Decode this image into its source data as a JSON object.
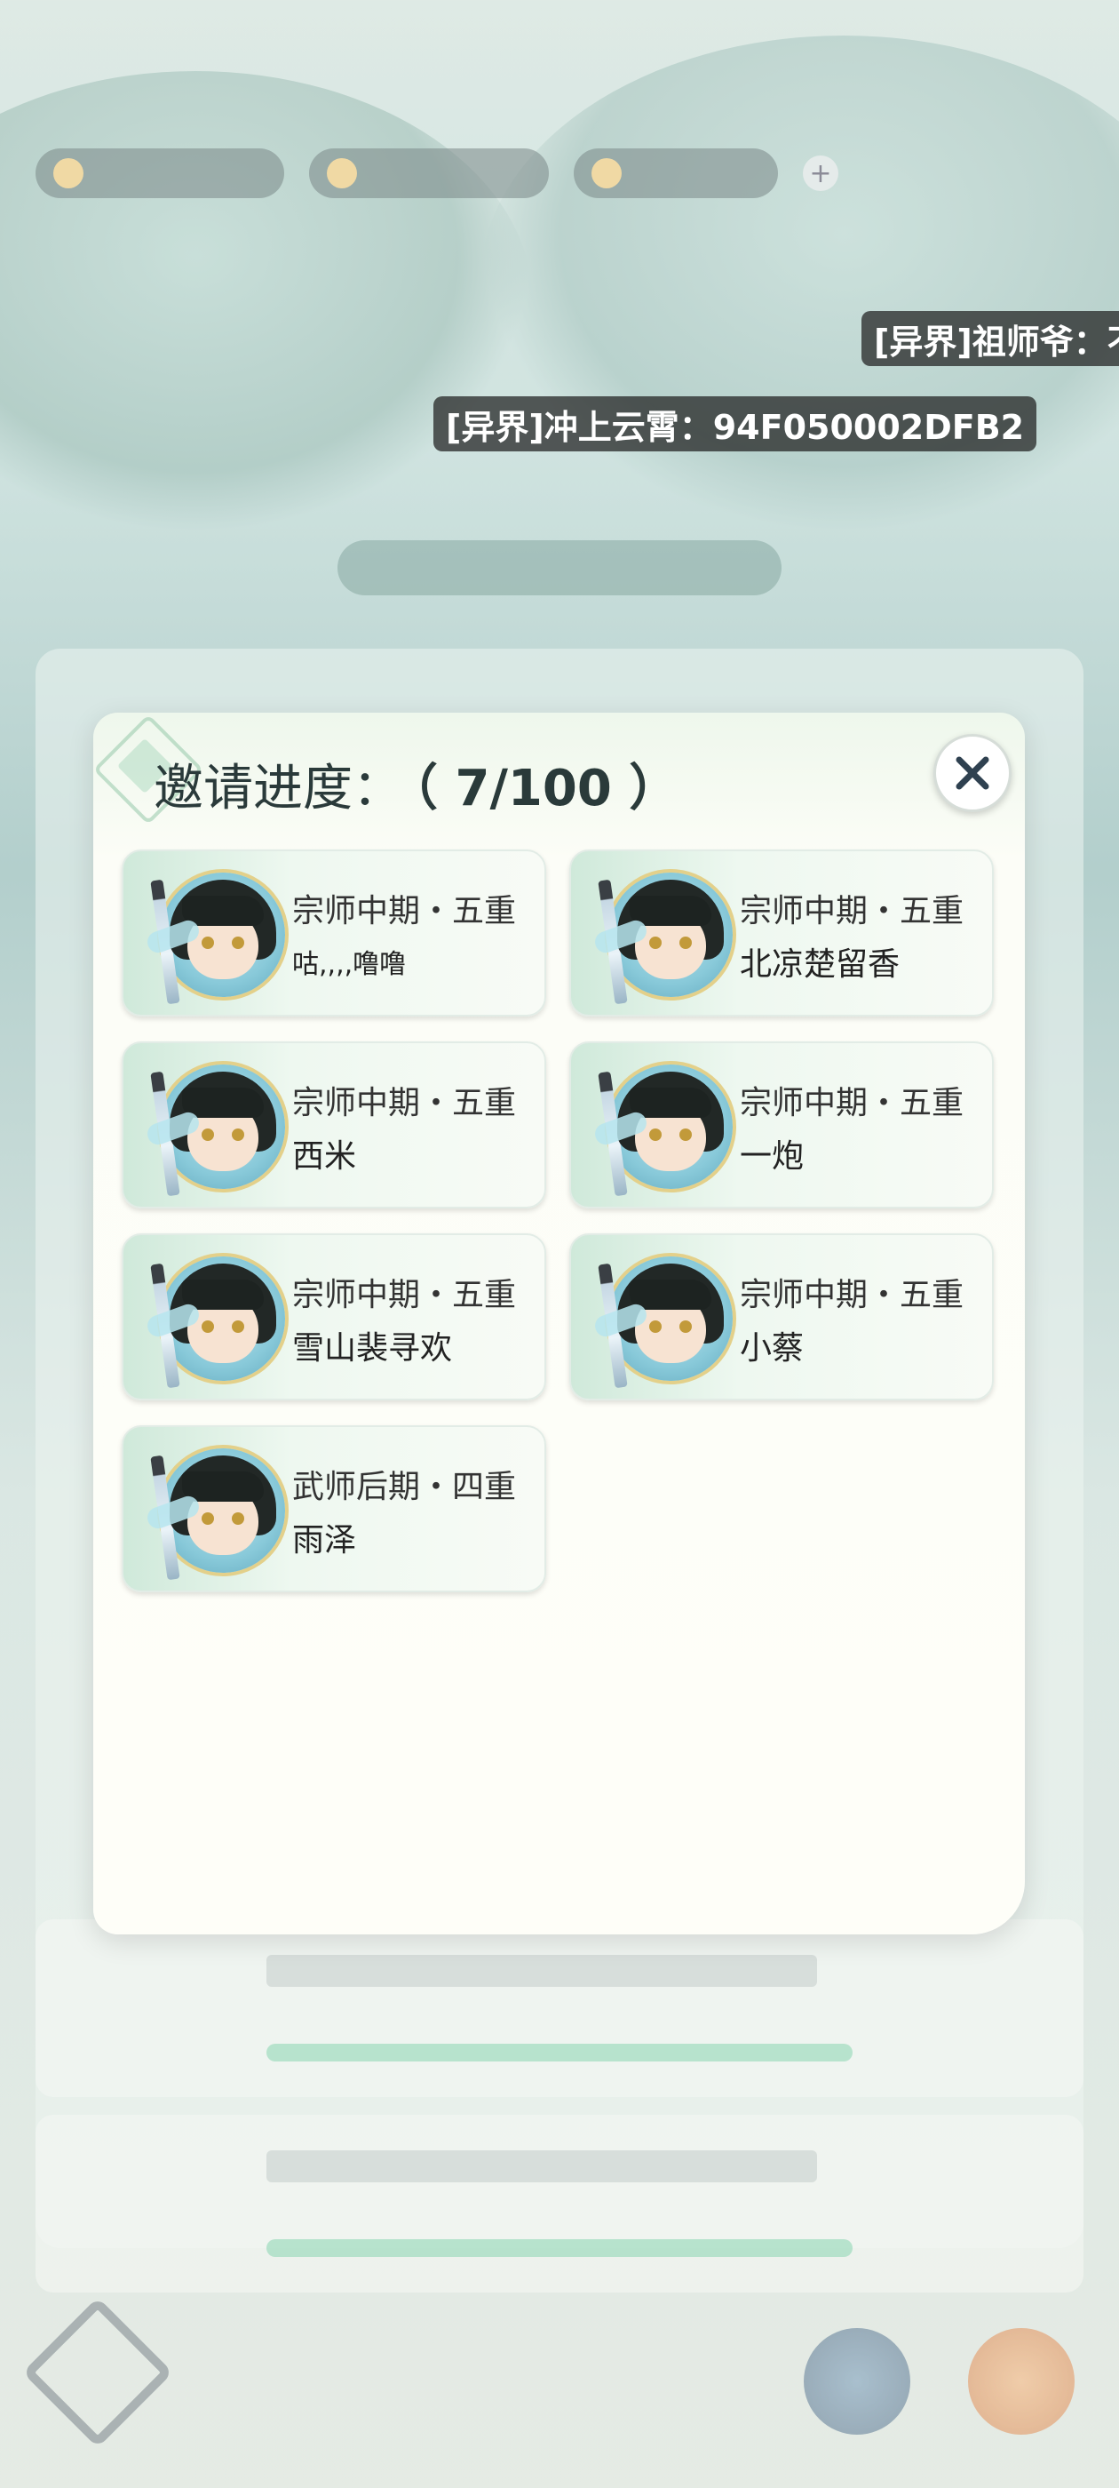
{
  "background": {
    "danmaku": [
      "[异界]祖师爷：不",
      "[异界]冲上云霄：94F050002DFB2"
    ]
  },
  "modal": {
    "title": "邀请进度：",
    "progress": "（ 7/100 ）",
    "invited_count": 7,
    "invite_total": 100,
    "close_icon": "close-icon",
    "invitees": [
      {
        "rank": "宗师中期・五重",
        "name": "咕,,,,噜噜"
      },
      {
        "rank": "宗师中期・五重",
        "name": "北凉楚留香"
      },
      {
        "rank": "宗师中期・五重",
        "name": "西米"
      },
      {
        "rank": "宗师中期・五重",
        "name": "一炮"
      },
      {
        "rank": "宗师中期・五重",
        "name": "雪山裴寻欢"
      },
      {
        "rank": "宗师中期・五重",
        "name": "小蔡"
      },
      {
        "rank": "武师后期・四重",
        "name": "雨泽"
      }
    ]
  },
  "colors": {
    "modal_bg": "#fefef8",
    "card_gradient_start": "#cfe9da",
    "danmaku_bg": "#1e1e1e",
    "progress_green": "#7fd0a8"
  }
}
